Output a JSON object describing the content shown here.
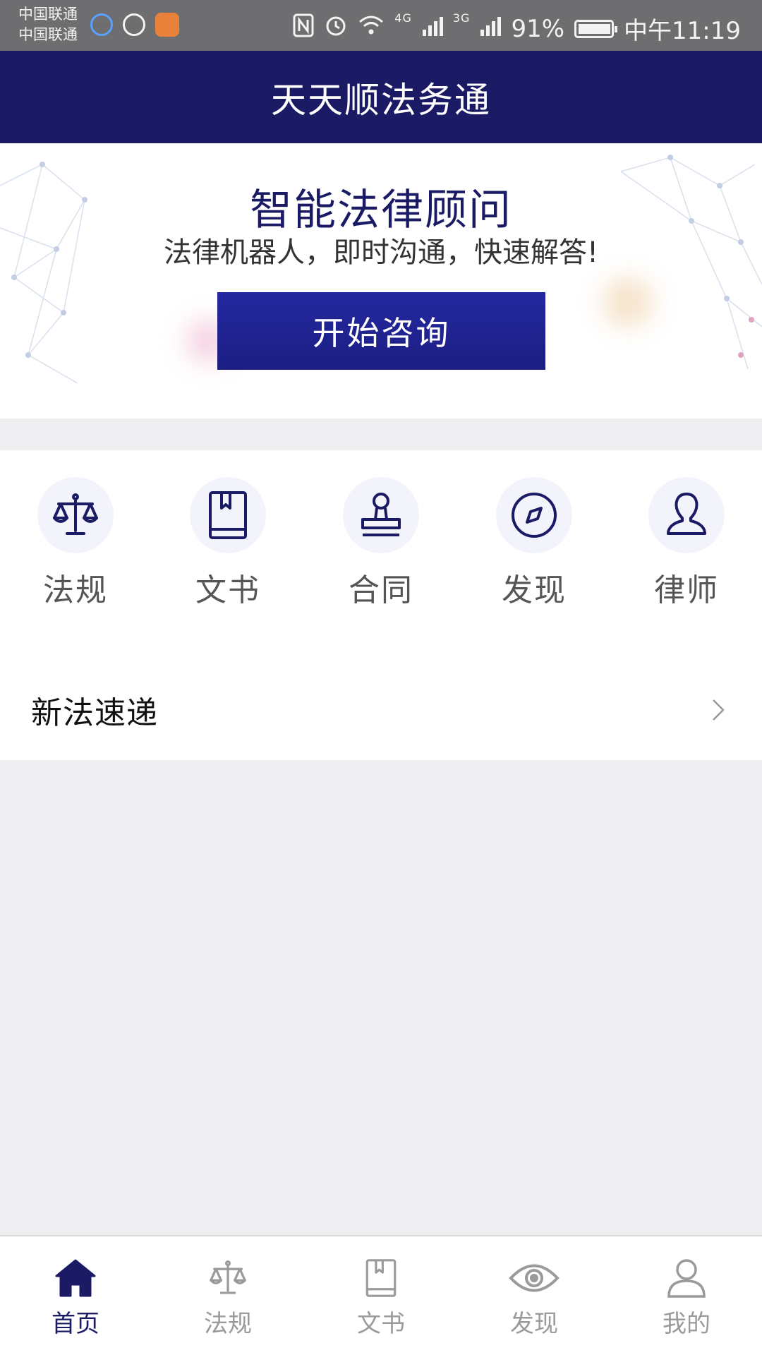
{
  "status_bar": {
    "carrier_1": "中国联通",
    "carrier_2": "中国联通",
    "network_1": "4G",
    "network_2": "3G",
    "battery": "91%",
    "time": "中午11:19"
  },
  "header": {
    "title": "天天顺法务通"
  },
  "banner": {
    "title": "智能法律顾问",
    "subtitle": "法律机器人，即时沟通，快速解答!",
    "cta_label": "开始咨询"
  },
  "shortcuts": [
    {
      "label": "法规",
      "icon": "scale-icon"
    },
    {
      "label": "文书",
      "icon": "book-icon"
    },
    {
      "label": "合同",
      "icon": "stamp-icon"
    },
    {
      "label": "发现",
      "icon": "compass-icon"
    },
    {
      "label": "律师",
      "icon": "person-icon"
    }
  ],
  "news": {
    "label": "新法速递"
  },
  "tabs": [
    {
      "label": "首页",
      "icon": "home-icon",
      "active": true
    },
    {
      "label": "法规",
      "icon": "scale-icon",
      "active": false
    },
    {
      "label": "文书",
      "icon": "book-icon",
      "active": false
    },
    {
      "label": "发现",
      "icon": "eye-icon",
      "active": false
    },
    {
      "label": "我的",
      "icon": "person-icon",
      "active": false
    }
  ],
  "colors": {
    "primary": "#1b1b65",
    "button": "#2428a0",
    "inactive": "#9a9a9a"
  }
}
